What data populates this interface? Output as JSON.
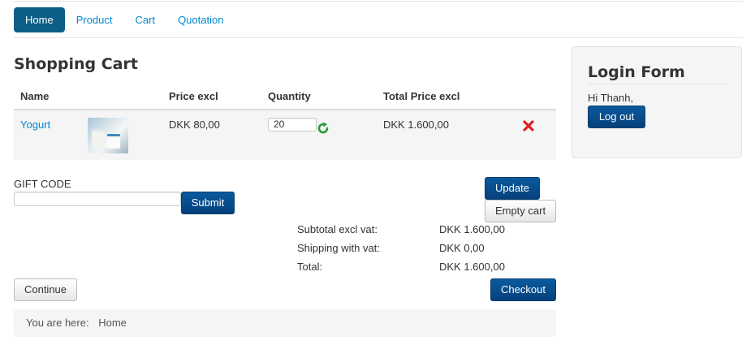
{
  "nav": {
    "tabs": [
      {
        "label": "Home",
        "active": true
      },
      {
        "label": "Product",
        "active": false
      },
      {
        "label": "Cart",
        "active": false
      },
      {
        "label": "Quotation",
        "active": false
      }
    ]
  },
  "page_title": "Shopping Cart",
  "cart": {
    "headers": {
      "name": "Name",
      "price": "Price excl",
      "quantity": "Quantity",
      "total": "Total Price excl"
    },
    "items": [
      {
        "name": "Yogurt",
        "price": "DKK 80,00",
        "quantity": "20",
        "total": "DKK 1.600,00",
        "thumbnail_icon": "yogurt-product-image"
      }
    ]
  },
  "gift": {
    "label": "GIFT CODE",
    "value": "",
    "submit_label": "Submit"
  },
  "buttons": {
    "update": "Update",
    "empty_cart": "Empty cart",
    "continue": "Continue",
    "checkout": "Checkout"
  },
  "totals": [
    {
      "label": "Subtotal excl vat:",
      "value": "DKK 1.600,00"
    },
    {
      "label": "Shipping with vat:",
      "value": "DKK 0,00"
    },
    {
      "label": "Total:",
      "value": "DKK 1.600,00"
    }
  ],
  "breadcrumb": {
    "prefix": "You are here:",
    "current": "Home"
  },
  "login": {
    "title": "Login Form",
    "greeting": "Hi Thanh,",
    "logout_label": "Log out"
  },
  "colors": {
    "link": "#0088cc",
    "primary": "#05417b",
    "active_tab": "#0e5f88",
    "delete": "#e02020",
    "refresh": "#2a9a3a"
  }
}
